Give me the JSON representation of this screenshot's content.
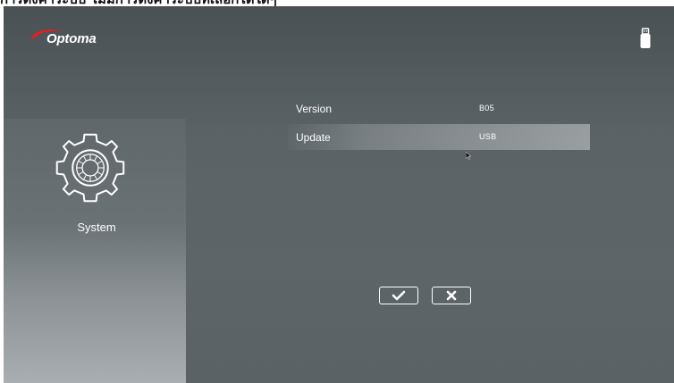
{
  "caption": "การตั้งค่าระบบ ไม่มีการตั้งค่าระบบที่เลือกได้ใดๆ",
  "header": {
    "brand": "Optoma",
    "brand_color": "#e21f26",
    "status_icon": "usb-drive-icon"
  },
  "sidebar": {
    "icon": "gear-icon",
    "label": "System"
  },
  "menu": {
    "rows": [
      {
        "label": "Version",
        "value": "B05",
        "selected": false
      },
      {
        "label": "Update",
        "value": "USB",
        "selected": true
      }
    ]
  },
  "buttons": {
    "confirm_icon": "check-icon",
    "cancel_icon": "close-icon"
  }
}
